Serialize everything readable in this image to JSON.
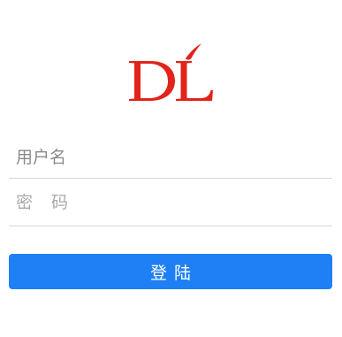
{
  "brand": {
    "logo_text": "DL",
    "logo_color": "#e2231a",
    "logo_name": "dl-logo"
  },
  "form": {
    "username": {
      "value": "",
      "placeholder": "用户名"
    },
    "password": {
      "value": "",
      "placeholder": "密　码"
    },
    "login_label": "登陆"
  },
  "colors": {
    "accent": "#1f80f5",
    "divider": "#d8d8d8",
    "background": "#ffffff"
  }
}
